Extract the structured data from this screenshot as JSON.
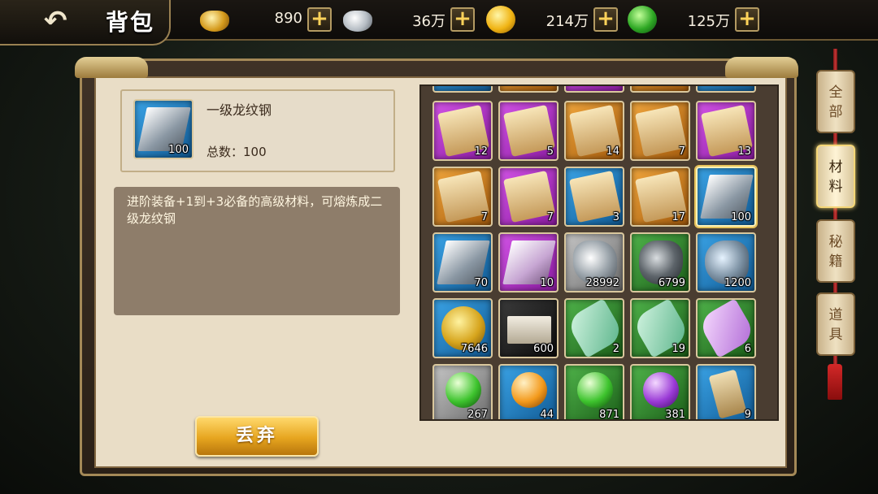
{
  "header": {
    "back_icon": "back-arrow-icon",
    "title": "背包"
  },
  "currencies": [
    {
      "icon": "gold-ingot-icon",
      "value": "890"
    },
    {
      "icon": "silver-ingot-icon",
      "value": "36万"
    },
    {
      "icon": "coin-icon",
      "value": "214万"
    },
    {
      "icon": "jade-token-icon",
      "value": "125万"
    }
  ],
  "selected_item": {
    "name": "一级龙纹钢",
    "count": "100",
    "total_text": "总数：100",
    "description": "进阶装备+1到+3必备的高级材料，可熔炼成二级龙纹钢"
  },
  "actions": {
    "discard_label": "丢弃"
  },
  "tabs": [
    {
      "label": "全部"
    },
    {
      "label": "材料"
    },
    {
      "label": "秘籍"
    },
    {
      "label": "道具"
    }
  ],
  "active_tab": "材料",
  "inventory": {
    "rows": [
      [
        {
          "rarity": "purple",
          "icon": "scroll-icon",
          "count": "12"
        },
        {
          "rarity": "purple",
          "icon": "scroll-icon",
          "count": "5"
        },
        {
          "rarity": "orange",
          "icon": "scroll-icon",
          "count": "14"
        },
        {
          "rarity": "orange",
          "icon": "scroll-icon",
          "count": "7"
        },
        {
          "rarity": "purple",
          "icon": "scroll-icon",
          "count": "13"
        }
      ],
      [
        {
          "rarity": "orange",
          "icon": "scroll-icon",
          "count": "7"
        },
        {
          "rarity": "purple",
          "icon": "scroll-icon",
          "count": "7"
        },
        {
          "rarity": "blue",
          "icon": "scroll-icon",
          "count": "3"
        },
        {
          "rarity": "orange",
          "icon": "scroll-icon",
          "count": "17"
        },
        {
          "rarity": "blue",
          "icon": "steel-ingot-icon",
          "count": "100",
          "selected": true
        }
      ],
      [
        {
          "rarity": "blue",
          "icon": "steel-ingot-icon",
          "count": "70"
        },
        {
          "rarity": "purple",
          "icon": "steel-ingot-icon",
          "count": "10"
        },
        {
          "rarity": "gray",
          "icon": "ore-icon",
          "count": "28992"
        },
        {
          "rarity": "green",
          "icon": "ore-icon",
          "count": "6799"
        },
        {
          "rarity": "blue",
          "icon": "ore-icon",
          "count": "1200"
        }
      ],
      [
        {
          "rarity": "blue",
          "icon": "gold-ore-icon",
          "count": "7646"
        },
        {
          "rarity": "black",
          "icon": "brick-icon",
          "count": "600"
        },
        {
          "rarity": "green",
          "icon": "ribbon-icon",
          "count": "2"
        },
        {
          "rarity": "green",
          "icon": "ribbon-icon",
          "count": "19"
        },
        {
          "rarity": "green",
          "icon": "ribbon-icon",
          "count": "6"
        }
      ],
      [
        {
          "rarity": "gray",
          "icon": "orb-icon",
          "count": "267"
        },
        {
          "rarity": "blue",
          "icon": "orb-icon",
          "count": "44"
        },
        {
          "rarity": "green",
          "icon": "orb-icon",
          "count": "871"
        },
        {
          "rarity": "green",
          "icon": "orb-icon",
          "count": "381"
        },
        {
          "rarity": "blue",
          "icon": "token-icon",
          "count": "9"
        }
      ]
    ]
  }
}
